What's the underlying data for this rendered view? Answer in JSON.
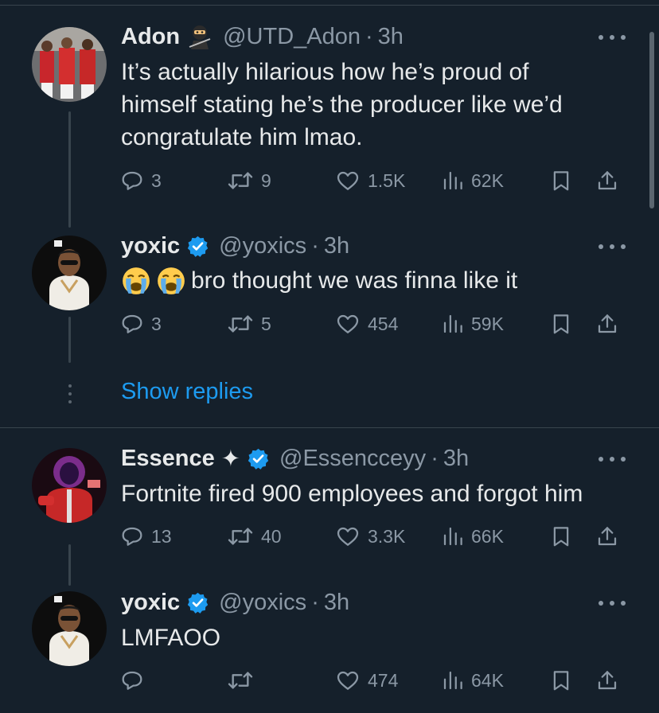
{
  "tweets": [
    {
      "name": "Adon",
      "name_emoji": "ninja-emoji",
      "verified": false,
      "handle": "@UTD_Adon",
      "separator": "·",
      "time": "3h",
      "text_lines": [
        "It’s actually hilarious how he’s proud of",
        "himself stating he’s the producer like we’d",
        "congratulate him lmao."
      ],
      "replies": "3",
      "retweets": "9",
      "likes": "1.5K",
      "views": "62K"
    },
    {
      "name": "yoxic",
      "verified": true,
      "handle": "@yoxics",
      "separator": "·",
      "time": "3h",
      "text_emojis": [
        "loudly-crying-face-emoji",
        "loudly-crying-face-emoji"
      ],
      "text": "bro thought we was finna like it",
      "replies": "3",
      "retweets": "5",
      "likes": "454",
      "views": "59K"
    },
    {
      "name": "Essence",
      "name_symbol": "✦",
      "verified": true,
      "handle": "@Essencceyy",
      "separator": "·",
      "time": "3h",
      "text": "Fortnite fired 900 employees and forgot him",
      "replies": "13",
      "retweets": "40",
      "likes": "3.3K",
      "views": "66K"
    },
    {
      "name": "yoxic",
      "verified": true,
      "handle": "@yoxics",
      "separator": "·",
      "time": "3h",
      "text": "LMFAOO",
      "replies": "",
      "retweets": "",
      "likes": "474",
      "views": "64K"
    }
  ],
  "show_replies": "Show replies",
  "colors": {
    "background": "#15202b",
    "text": "#e7e9ea",
    "secondary": "#8b98a5",
    "accent": "#1d9bf0",
    "divider": "#38444d"
  }
}
